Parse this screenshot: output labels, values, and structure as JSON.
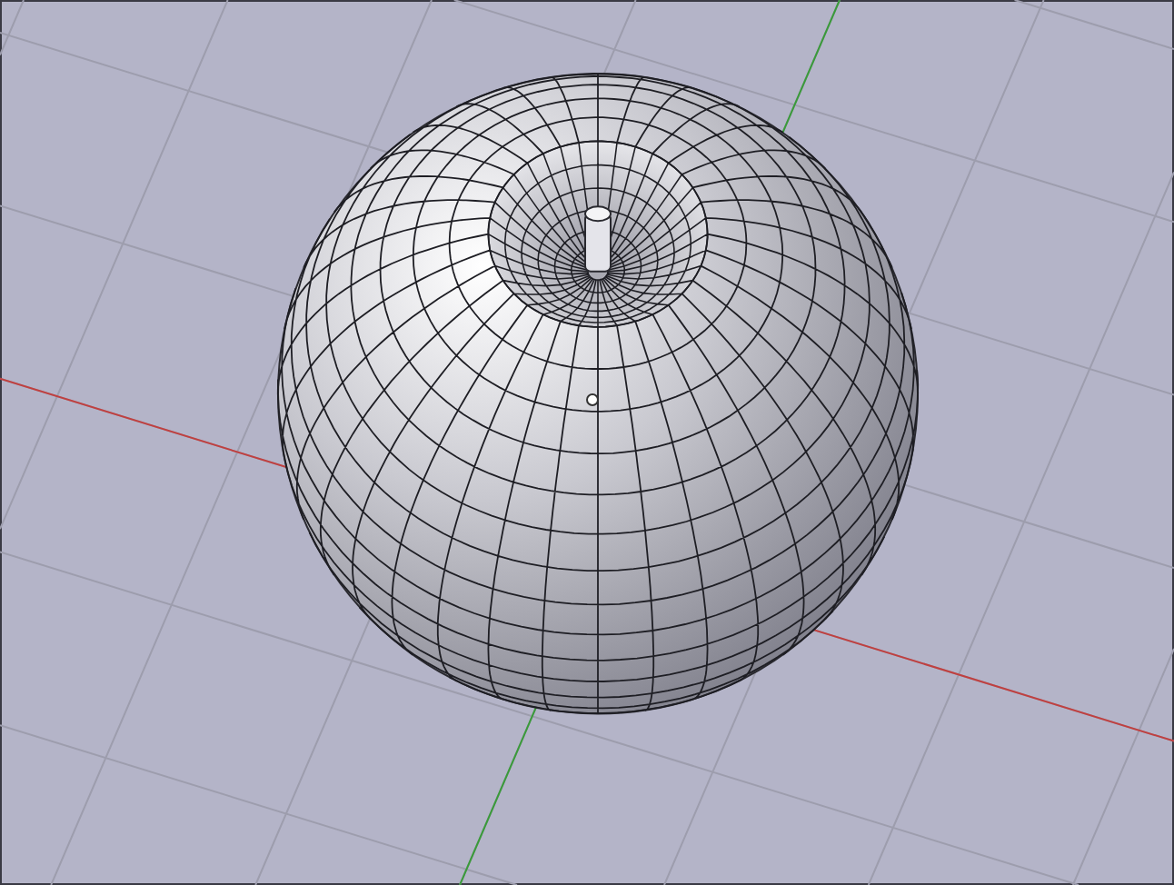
{
  "viewport": {
    "grid_visible": true,
    "axes_visible": true,
    "object_origin_visible": true
  }
}
